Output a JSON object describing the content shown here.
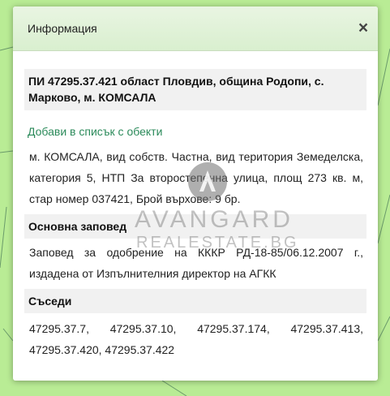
{
  "dialog": {
    "title": "Информация",
    "close_label": "×"
  },
  "parcel": {
    "heading": "ПИ 47295.37.421 област Пловдив, община Родопи, с. Марково, м. КОМСАЛА",
    "add_link": "Добави в списък с обекти",
    "details": "м. КОМСАЛА, вид собств. Частна, вид територия Земеделска, категория 5, НТП За второстепенна улица, площ 273 кв. м, стар номер 037421, Брой върхове: 9 бр."
  },
  "order": {
    "heading": "Основна заповед",
    "text": "Заповед за одобрение на КККР РД-18-85/06.12.2007 г., издадена от Изпълнителния директор на АГКК"
  },
  "neighbors": {
    "heading": "Съседи",
    "text": "47295.37.7, 47295.37.10, 47295.37.174, 47295.37.413, 47295.37.420, 47295.37.422"
  },
  "watermark": {
    "line1": "AVANGARD",
    "line2": "REALESTATE.BG"
  },
  "colors": {
    "map_background": "#b9ec95",
    "header_background": "#e2f2d9",
    "link": "#2b8a5a"
  }
}
